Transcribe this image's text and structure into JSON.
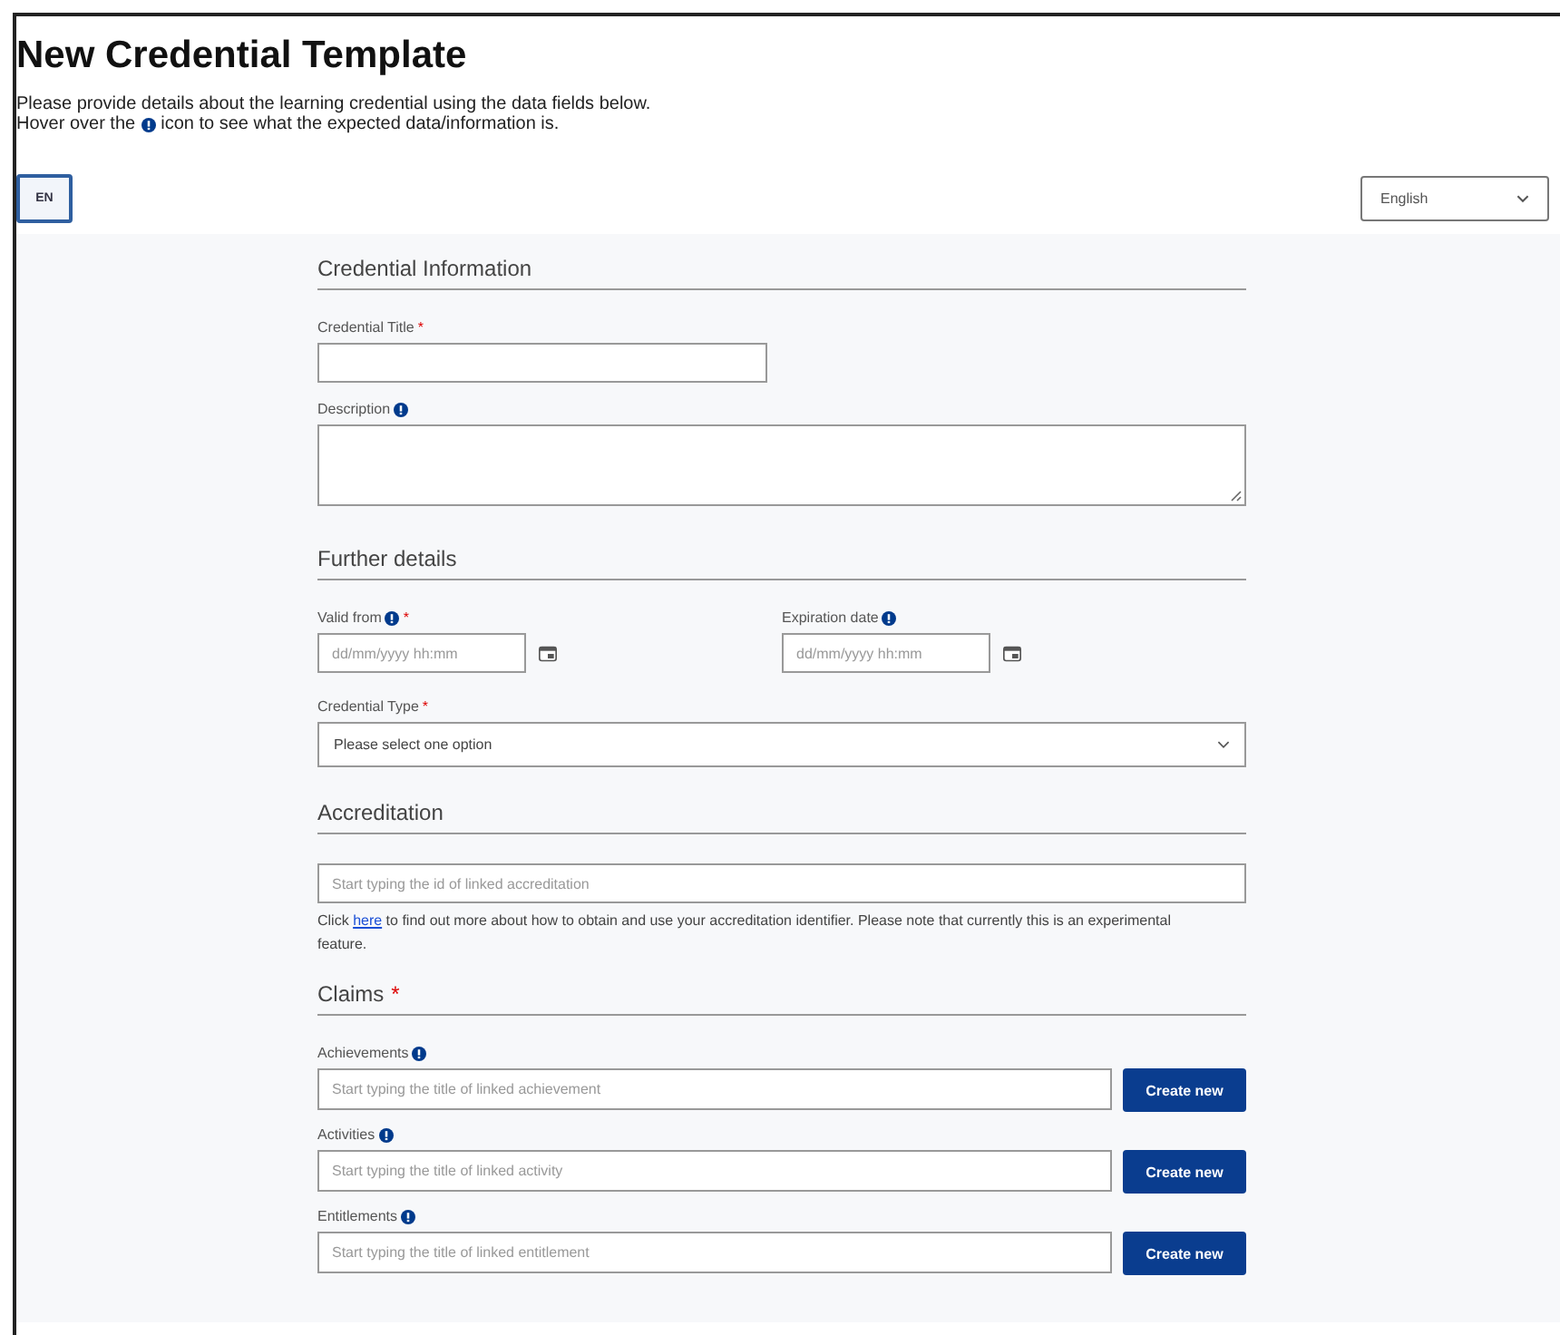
{
  "page": {
    "title": "New Credential Template",
    "intro_line_1": "Please provide details about the learning credential using the data fields below.",
    "intro_line_2": {
      "before": "Hover over the",
      "after": "icon to see what the expected data/information is."
    }
  },
  "language_tabs": [
    {
      "label": "EN",
      "selected": true
    }
  ],
  "language_select": {
    "value": "English"
  },
  "sections": [
    {
      "title": "Credential Information",
      "rows": [
        {
          "kind": "text",
          "label": "Credential Title",
          "asterisk": "*",
          "info": false
        },
        {
          "kind": "textarea",
          "label": "Description",
          "info": true
        }
      ]
    },
    {
      "title": "Further details",
      "rows": [
        {
          "kind": "dates",
          "fields": [
            {
              "label": "Valid from",
              "info": true,
              "asterisk": "*",
              "placeholder": "dd/mm/yyyy hh:mm"
            },
            {
              "label": "Expiration date",
              "info": true,
              "placeholder": "dd/mm/yyyy hh:mm"
            }
          ]
        },
        {
          "kind": "select",
          "label": "Credential Type",
          "asterisk": "*",
          "info": false,
          "value": "Please select one option"
        }
      ]
    },
    {
      "title": "Accreditation",
      "rows": [
        {
          "kind": "search",
          "placeholder": "Start typing the id of linked accreditation",
          "help": {
            "before": "Click",
            "link": "here",
            "after": "to find out more about how to obtain and use your accreditation identifier. Please note that currently this is an experimental feature."
          }
        }
      ]
    },
    {
      "title": "Claims",
      "asterisk": "*",
      "rows": [
        {
          "kind": "linked",
          "label": "Achievements",
          "info": true,
          "placeholder": "Start typing the title of linked achievement",
          "button": "Create new"
        },
        {
          "kind": "linked",
          "label": "Activities",
          "info": true,
          "placeholder": "Start typing the title of linked activity",
          "button": "Create new"
        },
        {
          "kind": "linked",
          "label": "Entitlements",
          "info": true,
          "placeholder": "Start typing the title of linked entitlement",
          "button": "Create new"
        }
      ]
    }
  ]
}
